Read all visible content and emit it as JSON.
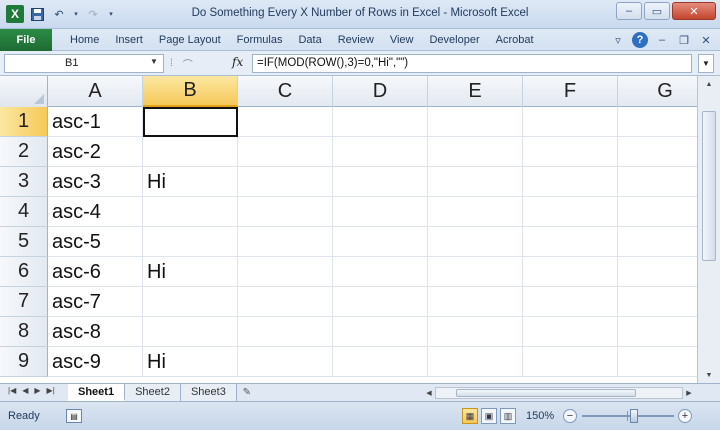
{
  "window": {
    "title": "Do Something Every X Number of Rows in Excel - Microsoft Excel",
    "controls": {
      "minimize": "–",
      "restore": "▭",
      "close": "✕"
    }
  },
  "quick_access": {
    "icons": [
      "excel-logo-icon",
      "save-icon",
      "undo-icon",
      "redo-icon",
      "customize-icon"
    ],
    "logo_text": "X"
  },
  "ribbon": {
    "file_tab": "File",
    "tabs": [
      "Home",
      "Insert",
      "Page Layout",
      "Formulas",
      "Data",
      "Review",
      "View",
      "Developer",
      "Acrobat"
    ],
    "right_icons": [
      "minimize-ribbon-icon",
      "help-icon",
      "restore-workbook-icon",
      "close-workbook-icon"
    ]
  },
  "formula_bar": {
    "name_box": "B1",
    "fx_label": "fx",
    "formula": "=IF(MOD(ROW(),3)=0,\"Hi\",\"\")"
  },
  "grid": {
    "columns": [
      "A",
      "B",
      "C",
      "D",
      "E",
      "F",
      "G"
    ],
    "active_column": "B",
    "active_row": "1",
    "rows": [
      {
        "num": "1",
        "A": "asc-1",
        "B": ""
      },
      {
        "num": "2",
        "A": "asc-2",
        "B": ""
      },
      {
        "num": "3",
        "A": "asc-3",
        "B": "Hi"
      },
      {
        "num": "4",
        "A": "asc-4",
        "B": ""
      },
      {
        "num": "5",
        "A": "asc-5",
        "B": ""
      },
      {
        "num": "6",
        "A": "asc-6",
        "B": "Hi"
      },
      {
        "num": "7",
        "A": "asc-7",
        "B": ""
      },
      {
        "num": "8",
        "A": "asc-8",
        "B": ""
      },
      {
        "num": "9",
        "A": "asc-9",
        "B": "Hi"
      }
    ]
  },
  "sheets": {
    "tabs": [
      "Sheet1",
      "Sheet2",
      "Sheet3"
    ],
    "active": "Sheet1"
  },
  "status": {
    "ready": "Ready",
    "zoom": "150%",
    "zoom_minus": "−",
    "zoom_plus": "+"
  }
}
